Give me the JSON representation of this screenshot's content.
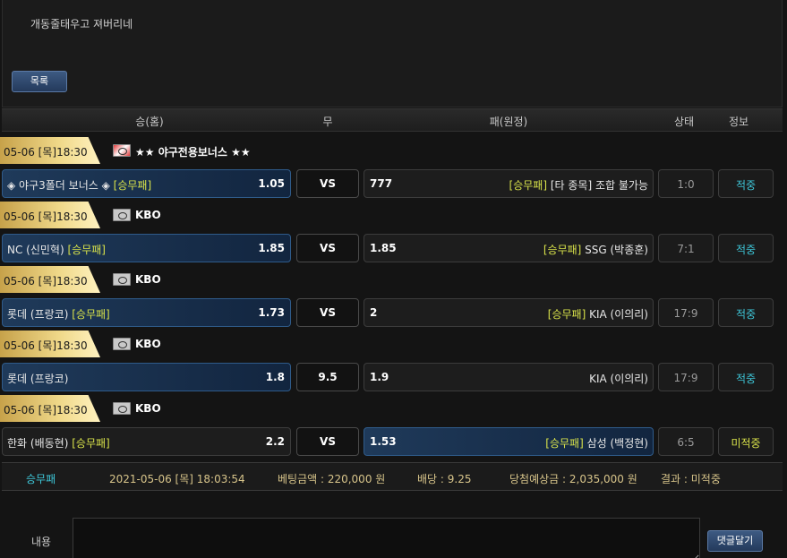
{
  "post": {
    "text": "개동줄태우고 져버리네"
  },
  "list_button": "목록",
  "table_header": {
    "home": "승(홈)",
    "draw": "무",
    "away": "패(원정)",
    "state": "상태",
    "info": "정보"
  },
  "games": [
    {
      "date": "05-06 [목]18:30",
      "league": "★★ 야구전용보너스 ★★",
      "league_icon": "bonus-flag-icon",
      "home_team": "◈ 야구3폴더 보너스 ◈",
      "home_tag": "[승무패]",
      "home_odds": "1.05",
      "draw": "VS",
      "away_odds": "777",
      "away_tag": "[승무패]",
      "away_team": "[타 종목] 조합 불가능",
      "score": "1:0",
      "result": "적중",
      "selected": "home"
    },
    {
      "date": "05-06 [목]18:30",
      "league": "KBO",
      "league_icon": "baseball-flag-icon",
      "home_team": "NC (신민혁)",
      "home_tag": "[승무패]",
      "home_odds": "1.85",
      "draw": "VS",
      "away_odds": "1.85",
      "away_tag": "[승무패]",
      "away_team": "SSG (박종훈)",
      "score": "7:1",
      "result": "적중",
      "selected": "home"
    },
    {
      "date": "05-06 [목]18:30",
      "league": "KBO",
      "league_icon": "baseball-flag-icon",
      "home_team": "롯데 (프랑코)",
      "home_tag": "[승무패]",
      "home_odds": "1.73",
      "draw": "VS",
      "away_odds": "2",
      "away_tag": "[승무패]",
      "away_team": "KIA (이의리)",
      "score": "17:9",
      "result": "적중",
      "selected": "home"
    },
    {
      "date": "05-06 [목]18:30",
      "league": "KBO",
      "league_icon": "baseball-flag-icon",
      "home_team": "롯데 (프랑코)",
      "home_tag": "",
      "home_odds": "1.8",
      "draw": "9.5",
      "away_odds": "1.9",
      "away_tag": "",
      "away_team": "KIA (이의리)",
      "score": "17:9",
      "result": "적중",
      "selected": "home"
    },
    {
      "date": "05-06 [목]18:30",
      "league": "KBO",
      "league_icon": "baseball-flag-icon",
      "home_team": "한화 (배동현)",
      "home_tag": "[승무패]",
      "home_odds": "2.2",
      "draw": "VS",
      "away_odds": "1.53",
      "away_tag": "[승무패]",
      "away_team": "삼성 (백정현)",
      "score": "6:5",
      "result": "미적중",
      "selected": "away"
    }
  ],
  "summary": {
    "type": "승무패",
    "datetime": "2021-05-06 [목] 18:03:54",
    "bet_amount": "베팅금액 : 220,000 원",
    "odds": "배당 : 9.25",
    "expected_win": "당첨예상금 : 2,035,000 원",
    "result": "결과 : 미적중"
  },
  "comment": {
    "label": "내용",
    "button": "댓글달기",
    "value": ""
  },
  "colors": {
    "hit": "#3ec7d9",
    "miss": "#d8e24a",
    "selected_bg": "#1f3a5a",
    "gold_tag": "#f0d98a"
  }
}
